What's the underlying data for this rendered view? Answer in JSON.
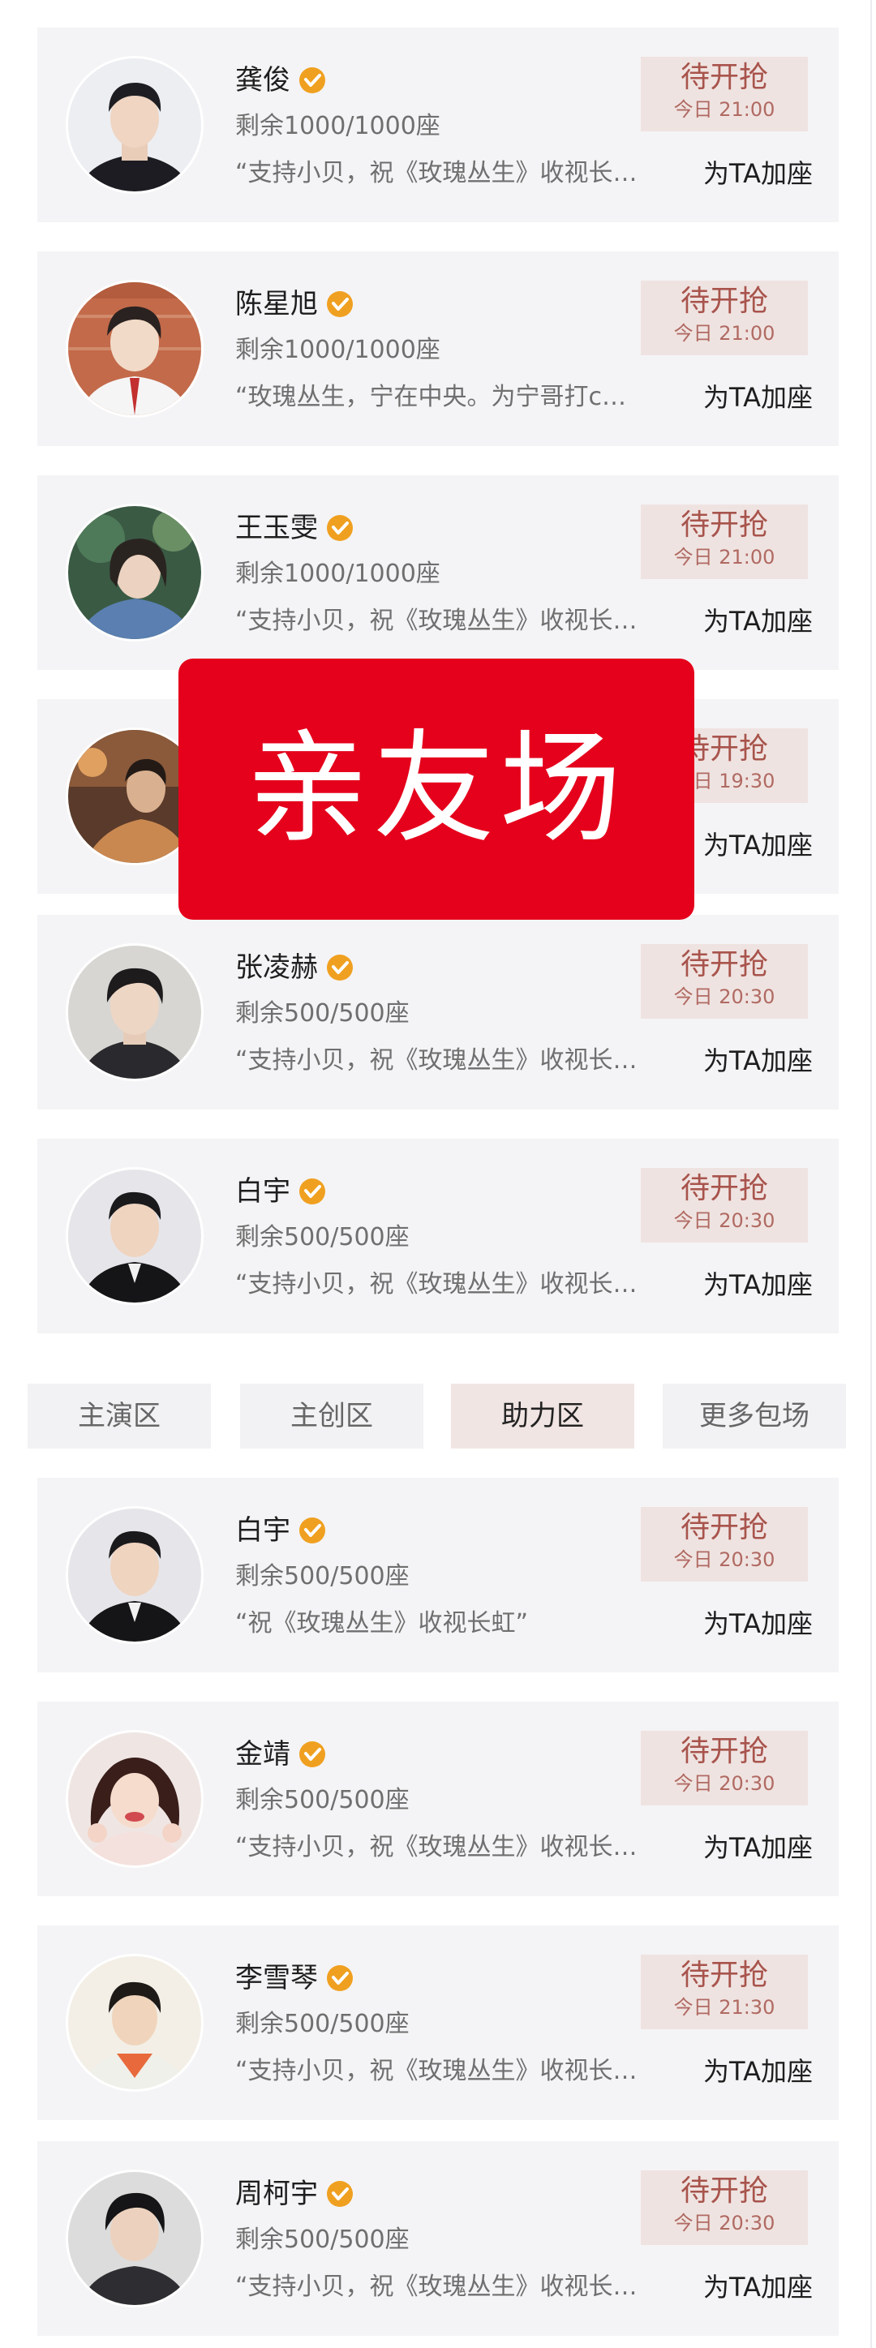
{
  "colors": {
    "card_bg": "#f4f4f6",
    "status_bg": "#efe3e1",
    "status_text": "#a8544c",
    "verified_badge": "#f0a020",
    "overlay_bg": "#e5001c",
    "active_tab_bg": "#f1e5e3"
  },
  "icons": {
    "verified": "verified-badge-icon"
  },
  "top_cards": [
    {
      "name": "龚俊",
      "seats": "剩余1000/1000座",
      "message": "“支持小贝，祝《玫瑰丛生》收视长虹”",
      "status": "待开抢",
      "time": "今日 21:00",
      "action": "为TA加座"
    },
    {
      "name": "陈星旭",
      "seats": "剩余1000/1000座",
      "message": "“玫瑰丛生，宁在中央。为宁哥打call”",
      "status": "待开抢",
      "time": "今日 21:00",
      "action": "为TA加座"
    },
    {
      "name": "王玉雯",
      "seats": "剩余1000/1000座",
      "message": "“支持小贝，祝《玫瑰丛生》收视长虹”",
      "status": "待开抢",
      "time": "今日 21:00",
      "action": "为TA加座"
    },
    {
      "name": "",
      "seats": "",
      "message": "",
      "status": "待开抢",
      "time": "今日 19:30",
      "action": "为TA加座"
    },
    {
      "name": "张凌赫",
      "seats": "剩余500/500座",
      "message": "“支持小贝，祝《玫瑰丛生》收视长虹”",
      "status": "待开抢",
      "time": "今日 20:30",
      "action": "为TA加座"
    },
    {
      "name": "白宇",
      "seats": "剩余500/500座",
      "message": "“支持小贝，祝《玫瑰丛生》收视长虹”",
      "status": "待开抢",
      "time": "今日 20:30",
      "action": "为TA加座"
    }
  ],
  "tabs": [
    {
      "label": "主演区",
      "active": false
    },
    {
      "label": "主创区",
      "active": false
    },
    {
      "label": "助力区",
      "active": true
    },
    {
      "label": "更多包场",
      "active": false
    }
  ],
  "bottom_cards": [
    {
      "name": "白宇",
      "seats": "剩余500/500座",
      "message": "“祝《玫瑰丛生》收视长虹”",
      "status": "待开抢",
      "time": "今日 20:30",
      "action": "为TA加座"
    },
    {
      "name": "金靖",
      "seats": "剩余500/500座",
      "message": "“支持小贝，祝《玫瑰丛生》收视长虹”",
      "status": "待开抢",
      "time": "今日 20:30",
      "action": "为TA加座"
    },
    {
      "name": "李雪琴",
      "seats": "剩余500/500座",
      "message": "“支持小贝，祝《玫瑰丛生》收视长虹”",
      "status": "待开抢",
      "time": "今日 21:30",
      "action": "为TA加座"
    },
    {
      "name": "周柯宇",
      "seats": "剩余500/500座",
      "message": "“支持小贝，祝《玫瑰丛生》收视长虹”",
      "status": "待开抢",
      "time": "今日 20:30",
      "action": "为TA加座"
    }
  ],
  "overlay": {
    "text": "亲友场"
  }
}
